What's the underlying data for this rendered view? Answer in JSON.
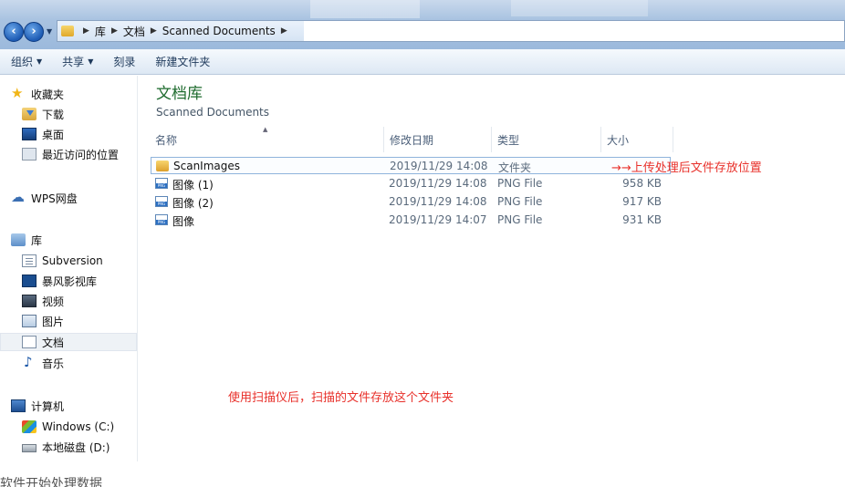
{
  "address_bar": {
    "breadcrumbs": [
      "库",
      "文档",
      "Scanned Documents"
    ]
  },
  "toolbar": {
    "organize": "组织",
    "share": "共享",
    "burn": "刻录",
    "new_folder": "新建文件夹"
  },
  "nav_pane": {
    "favorites": "收藏夹",
    "downloads": "下载",
    "desktop": "桌面",
    "recent": "最近访问的位置",
    "wps": "WPS网盘",
    "libraries": "库",
    "subversion": "Subversion",
    "storm": "暴风影视库",
    "videos": "视频",
    "pictures": "图片",
    "documents": "文档",
    "music": "音乐",
    "computer": "计算机",
    "drive_c": "Windows (C:)",
    "drive_d": "本地磁盘 (D:)"
  },
  "library": {
    "title": "文档库",
    "subtitle": "Scanned Documents"
  },
  "columns": {
    "name": "名称",
    "date": "修改日期",
    "type": "类型",
    "size": "大小"
  },
  "files": [
    {
      "name": "ScanImages",
      "date": "2019/11/29 14:08",
      "type": "文件夹",
      "size": ""
    },
    {
      "name": "图像 (1)",
      "date": "2019/11/29 14:08",
      "type": "PNG File",
      "size": "958 KB"
    },
    {
      "name": "图像 (2)",
      "date": "2019/11/29 14:08",
      "type": "PNG File",
      "size": "917 KB"
    },
    {
      "name": "图像",
      "date": "2019/11/29 14:07",
      "type": "PNG File",
      "size": "931 KB"
    }
  ],
  "annotations": {
    "folder_note": "→→上传处理后文件存放位置",
    "scan_note": "使用扫描仪后，扫描的文件存放这个文件夹"
  },
  "page_text": {
    "bottom": "软件开始处理数据"
  },
  "colors": {
    "library_title": "#1e6b2e",
    "annotation": "#e8302a",
    "selection_border": "#8fb4dc"
  }
}
